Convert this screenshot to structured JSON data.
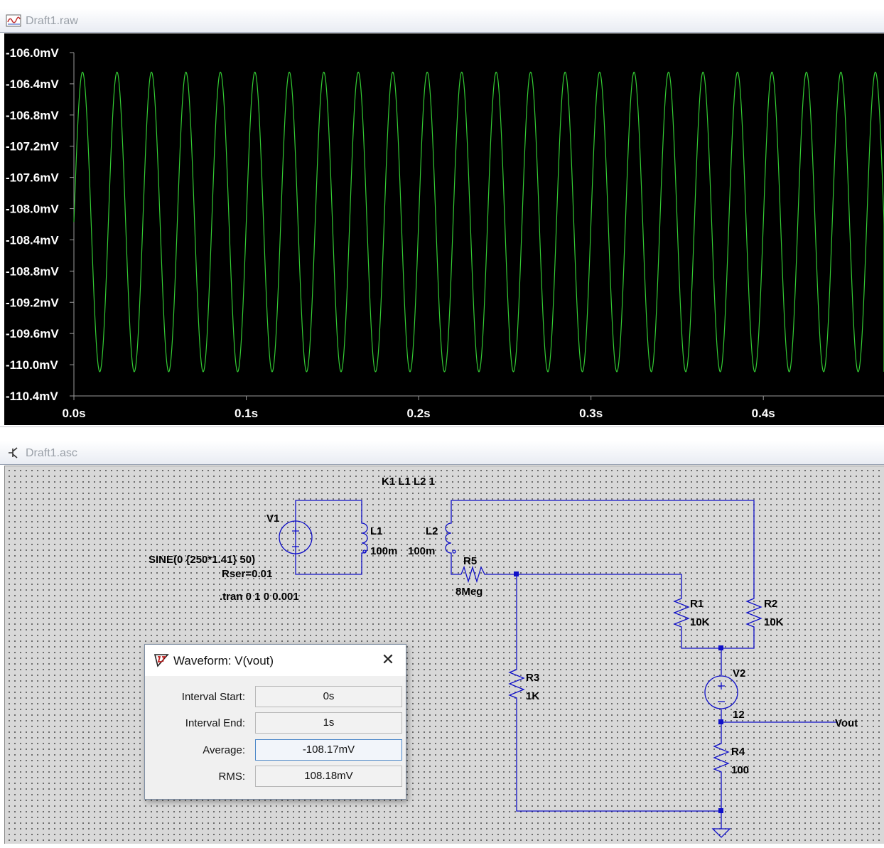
{
  "raw_window": {
    "title": "Draft1.raw",
    "plot": {
      "y_labels": [
        "-106.0mV",
        "-106.4mV",
        "-106.8mV",
        "-107.2mV",
        "-107.6mV",
        "-108.0mV",
        "-108.4mV",
        "-108.8mV",
        "-109.2mV",
        "-109.6mV",
        "-110.0mV",
        "-110.4mV"
      ],
      "x_labels": [
        "0.0s",
        "0.1s",
        "0.2s",
        "0.3s",
        "0.4s"
      ],
      "trace_color": "#33cc33",
      "background": "#000000"
    }
  },
  "chart_data": {
    "type": "line",
    "title": "",
    "xlabel": "",
    "ylabel": "",
    "series": [
      {
        "name": "V(vout)",
        "frequency_hz": 50,
        "mean_mv": -108.17,
        "amplitude_mv": 1.92,
        "x_start_s": 0.0,
        "x_end_s": 0.48
      }
    ],
    "xlim": [
      0.0,
      0.47
    ],
    "ylim": [
      -110.4,
      -106.0
    ],
    "x_ticks": [
      0.0,
      0.1,
      0.2,
      0.3,
      0.4
    ],
    "y_ticks": [
      -106.0,
      -106.4,
      -106.8,
      -107.2,
      -107.6,
      -108.0,
      -108.4,
      -108.8,
      -109.2,
      -109.6,
      -110.0,
      -110.4
    ],
    "grid": false
  },
  "asc_window": {
    "title": "Draft1.asc",
    "schematic": {
      "coupling": "K1 L1 L2 1",
      "v1_name": "V1",
      "v1_value": "SINE(0 {250*1.41} 50)",
      "v1_rser": "Rser=0.01",
      "tran": ".tran 0 1 0 0.001",
      "l1_name": "L1",
      "l1_value": "100m",
      "l2_name": "L2",
      "l2_value": "100m",
      "r5_name": "R5",
      "r5_value": "8Meg",
      "r1_name": "R1",
      "r1_value": "10K",
      "r2_name": "R2",
      "r2_value": "10K",
      "r3_name": "R3",
      "r3_value": "1K",
      "v2_name": "V2",
      "v2_value": "12",
      "r4_name": "R4",
      "r4_value": "100",
      "vout_label": "Vout",
      "wire_color": "#1010c8"
    }
  },
  "dialog": {
    "title": "Waveform: V(vout)",
    "close_symbol": "✕",
    "rows": [
      {
        "label": "Interval Start:",
        "value": "0s"
      },
      {
        "label": "Interval End:",
        "value": "1s"
      },
      {
        "label": "Average:",
        "value": "-108.17mV"
      },
      {
        "label": "RMS:",
        "value": "108.18mV"
      }
    ]
  }
}
